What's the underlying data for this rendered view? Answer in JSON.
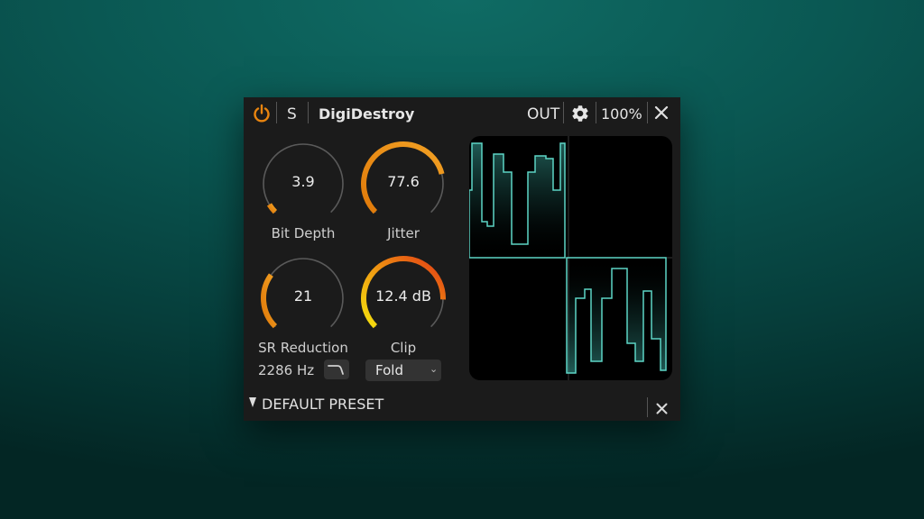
{
  "titlebar": {
    "solo_label": "S",
    "plugin_name": "DigiDestroy",
    "output_label": "OUT",
    "zoom_label": "100%"
  },
  "knobs": {
    "bit_depth": {
      "value": "3.9",
      "label": "Bit Depth",
      "level": 0.05
    },
    "jitter": {
      "value": "77.6",
      "label": "Jitter",
      "level": 0.78
    },
    "sr_reduction": {
      "value": "21",
      "label": "SR Reduction",
      "level": 0.3,
      "frequency": "2286 Hz"
    },
    "clip": {
      "value": "12.4 dB",
      "label": "Clip",
      "level": 0.84,
      "mode": "Fold"
    }
  },
  "preset": {
    "name": "DEFAULT PRESET"
  },
  "colors": {
    "accent": "#e8840f",
    "scope_line": "#5dd5c6",
    "panel_bg": "#1b1b1b",
    "background": "#0a5752"
  },
  "icons": {
    "power": "power-icon",
    "settings": "gear-icon",
    "close": "close-icon",
    "filter": "lowpass-filter-icon",
    "dropdown": "chevron-down-icon",
    "collapse": "triangle-down-icon"
  }
}
